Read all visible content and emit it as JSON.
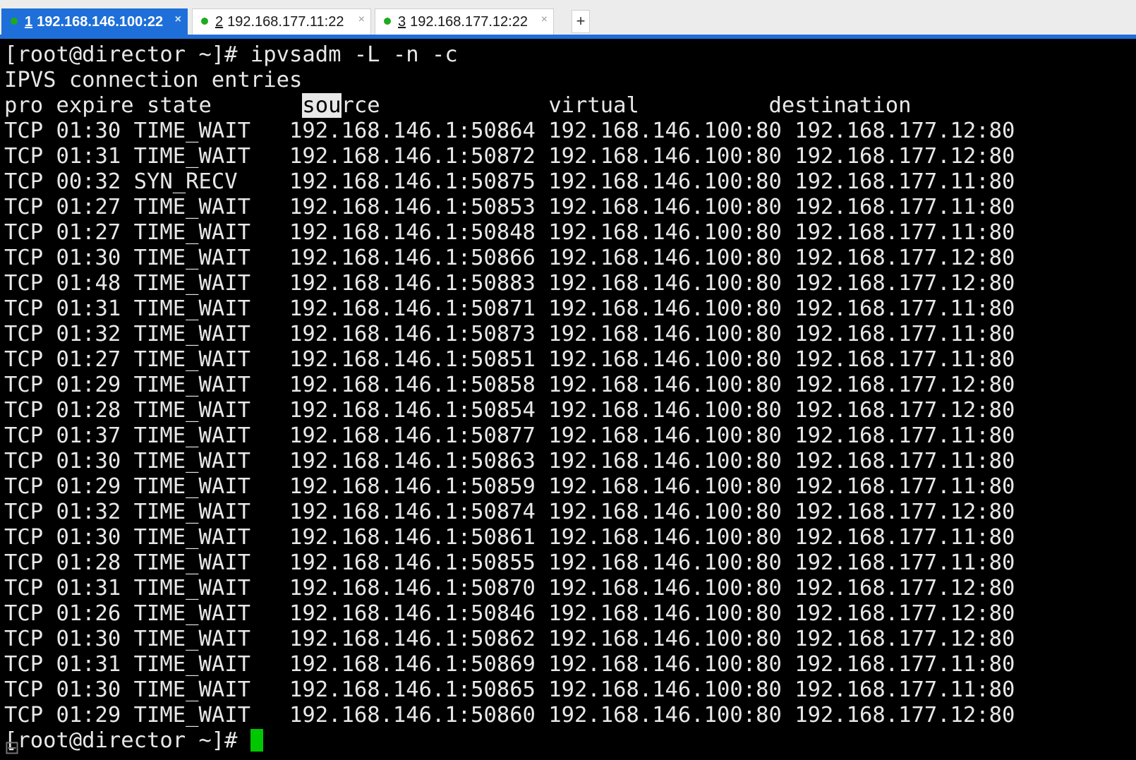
{
  "tabs": [
    {
      "num": "1",
      "host": "192.168.146.100:22",
      "active": true
    },
    {
      "num": "2",
      "host": "192.168.177.11:22",
      "active": false
    },
    {
      "num": "3",
      "host": "192.168.177.12:22",
      "active": false
    }
  ],
  "new_tab_label": "+",
  "close_glyph": "×",
  "terminal": {
    "command_line": "[root@director ~]# ipvsadm -L -n -c",
    "subtitle": "IPVS connection entries",
    "header": {
      "pro": "pro",
      "expire": "expire",
      "state": "state",
      "source_highlight": "sou",
      "source_rest": "rce",
      "virtual": "virtual",
      "destination": "destination"
    },
    "rows": [
      [
        "TCP",
        "01:30",
        "TIME_WAIT",
        "192.168.146.1:50864",
        "192.168.146.100:80",
        "192.168.177.12:80"
      ],
      [
        "TCP",
        "01:31",
        "TIME_WAIT",
        "192.168.146.1:50872",
        "192.168.146.100:80",
        "192.168.177.12:80"
      ],
      [
        "TCP",
        "00:32",
        "SYN_RECV",
        "192.168.146.1:50875",
        "192.168.146.100:80",
        "192.168.177.11:80"
      ],
      [
        "TCP",
        "01:27",
        "TIME_WAIT",
        "192.168.146.1:50853",
        "192.168.146.100:80",
        "192.168.177.11:80"
      ],
      [
        "TCP",
        "01:27",
        "TIME_WAIT",
        "192.168.146.1:50848",
        "192.168.146.100:80",
        "192.168.177.11:80"
      ],
      [
        "TCP",
        "01:30",
        "TIME_WAIT",
        "192.168.146.1:50866",
        "192.168.146.100:80",
        "192.168.177.12:80"
      ],
      [
        "TCP",
        "01:48",
        "TIME_WAIT",
        "192.168.146.1:50883",
        "192.168.146.100:80",
        "192.168.177.12:80"
      ],
      [
        "TCP",
        "01:31",
        "TIME_WAIT",
        "192.168.146.1:50871",
        "192.168.146.100:80",
        "192.168.177.11:80"
      ],
      [
        "TCP",
        "01:32",
        "TIME_WAIT",
        "192.168.146.1:50873",
        "192.168.146.100:80",
        "192.168.177.11:80"
      ],
      [
        "TCP",
        "01:27",
        "TIME_WAIT",
        "192.168.146.1:50851",
        "192.168.146.100:80",
        "192.168.177.11:80"
      ],
      [
        "TCP",
        "01:29",
        "TIME_WAIT",
        "192.168.146.1:50858",
        "192.168.146.100:80",
        "192.168.177.12:80"
      ],
      [
        "TCP",
        "01:28",
        "TIME_WAIT",
        "192.168.146.1:50854",
        "192.168.146.100:80",
        "192.168.177.12:80"
      ],
      [
        "TCP",
        "01:37",
        "TIME_WAIT",
        "192.168.146.1:50877",
        "192.168.146.100:80",
        "192.168.177.11:80"
      ],
      [
        "TCP",
        "01:30",
        "TIME_WAIT",
        "192.168.146.1:50863",
        "192.168.146.100:80",
        "192.168.177.11:80"
      ],
      [
        "TCP",
        "01:29",
        "TIME_WAIT",
        "192.168.146.1:50859",
        "192.168.146.100:80",
        "192.168.177.11:80"
      ],
      [
        "TCP",
        "01:32",
        "TIME_WAIT",
        "192.168.146.1:50874",
        "192.168.146.100:80",
        "192.168.177.12:80"
      ],
      [
        "TCP",
        "01:30",
        "TIME_WAIT",
        "192.168.146.1:50861",
        "192.168.146.100:80",
        "192.168.177.11:80"
      ],
      [
        "TCP",
        "01:28",
        "TIME_WAIT",
        "192.168.146.1:50855",
        "192.168.146.100:80",
        "192.168.177.11:80"
      ],
      [
        "TCP",
        "01:31",
        "TIME_WAIT",
        "192.168.146.1:50870",
        "192.168.146.100:80",
        "192.168.177.12:80"
      ],
      [
        "TCP",
        "01:26",
        "TIME_WAIT",
        "192.168.146.1:50846",
        "192.168.146.100:80",
        "192.168.177.12:80"
      ],
      [
        "TCP",
        "01:30",
        "TIME_WAIT",
        "192.168.146.1:50862",
        "192.168.146.100:80",
        "192.168.177.12:80"
      ],
      [
        "TCP",
        "01:31",
        "TIME_WAIT",
        "192.168.146.1:50869",
        "192.168.146.100:80",
        "192.168.177.11:80"
      ],
      [
        "TCP",
        "01:30",
        "TIME_WAIT",
        "192.168.146.1:50865",
        "192.168.146.100:80",
        "192.168.177.11:80"
      ],
      [
        "TCP",
        "01:29",
        "TIME_WAIT",
        "192.168.146.1:50860",
        "192.168.146.100:80",
        "192.168.177.12:80"
      ]
    ],
    "prompt": "[root@director ~]# "
  },
  "colors": {
    "accent": "#1e6fd9",
    "cursor": "#00c800",
    "terminal_bg": "#000000",
    "terminal_fg": "#e8e8e8",
    "status_dot": "#1faa1f"
  },
  "icons": {
    "tab_status": "status-dot-icon",
    "tab_close": "close-icon",
    "new_tab": "plus-icon",
    "corner": "window-icon"
  }
}
